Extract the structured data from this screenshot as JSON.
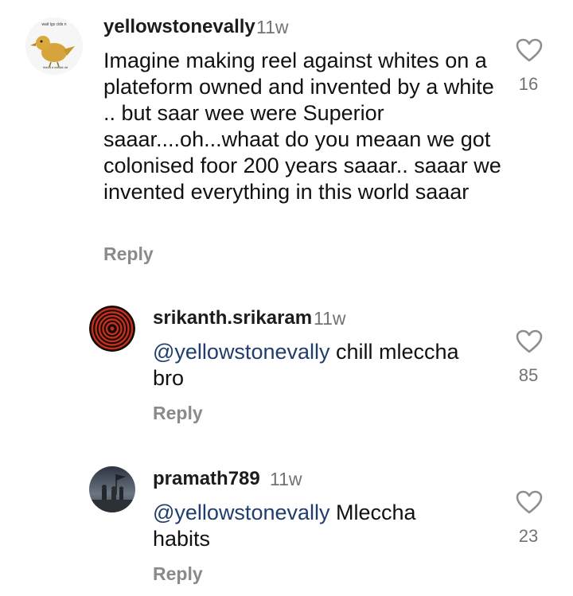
{
  "comments": [
    {
      "username": "yellowstonevally",
      "time": "11w",
      "text": "Imagine making reel against whites on a plateform owned and invented by a white .. but saar wee were Superior saaar....oh...whaat do you meaan we got colonised foor 200 years saaar.. saaar we invented everything in this world saaar",
      "reply_label": "Reply",
      "likes": "16",
      "avatar_icon": "bird-meme-avatar-icon",
      "avatar_caption_top": "wait lgs clds n",
      "avatar_caption_bottom": "hiddd d ddddd dd"
    },
    {
      "username": "srikanth.srikaram",
      "time": "11w",
      "mention": "@yellowstonevally",
      "text": " chill mleccha bro",
      "reply_label": "Reply",
      "likes": "85",
      "avatar_icon": "concentric-circles-avatar-icon"
    },
    {
      "username": "pramath789",
      "time": "11w",
      "mention": "@yellowstonevally",
      "text": " Mleccha habits",
      "reply_label": "Reply",
      "likes": "23",
      "avatar_icon": "soldiers-flag-avatar-icon"
    }
  ],
  "colors": {
    "mention": "#1f3e6e",
    "muted": "#737373",
    "reply": "#8a8a8a"
  }
}
